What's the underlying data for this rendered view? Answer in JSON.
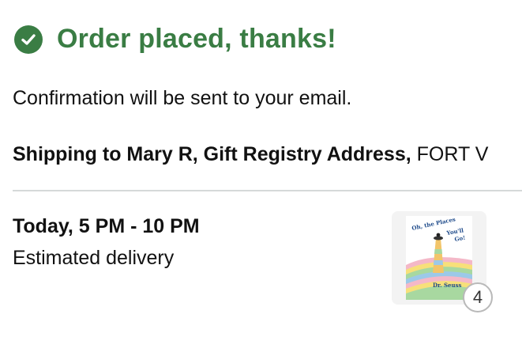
{
  "header": {
    "title": "Order placed, thanks!",
    "icon": "check-circle-icon",
    "color": "#3a7d44"
  },
  "confirmation": "Confirmation will be sent to your email.",
  "shipping": {
    "label_bold": "Shipping to Mary R, Gift Registry Address,",
    "rest": " FORT V"
  },
  "delivery": {
    "window": "Today, 5 PM - 10 PM",
    "label": "Estimated delivery"
  },
  "item": {
    "cover_title": "Oh, the Places You'll Go!",
    "author": "Dr. Seuss",
    "quantity": "4"
  }
}
